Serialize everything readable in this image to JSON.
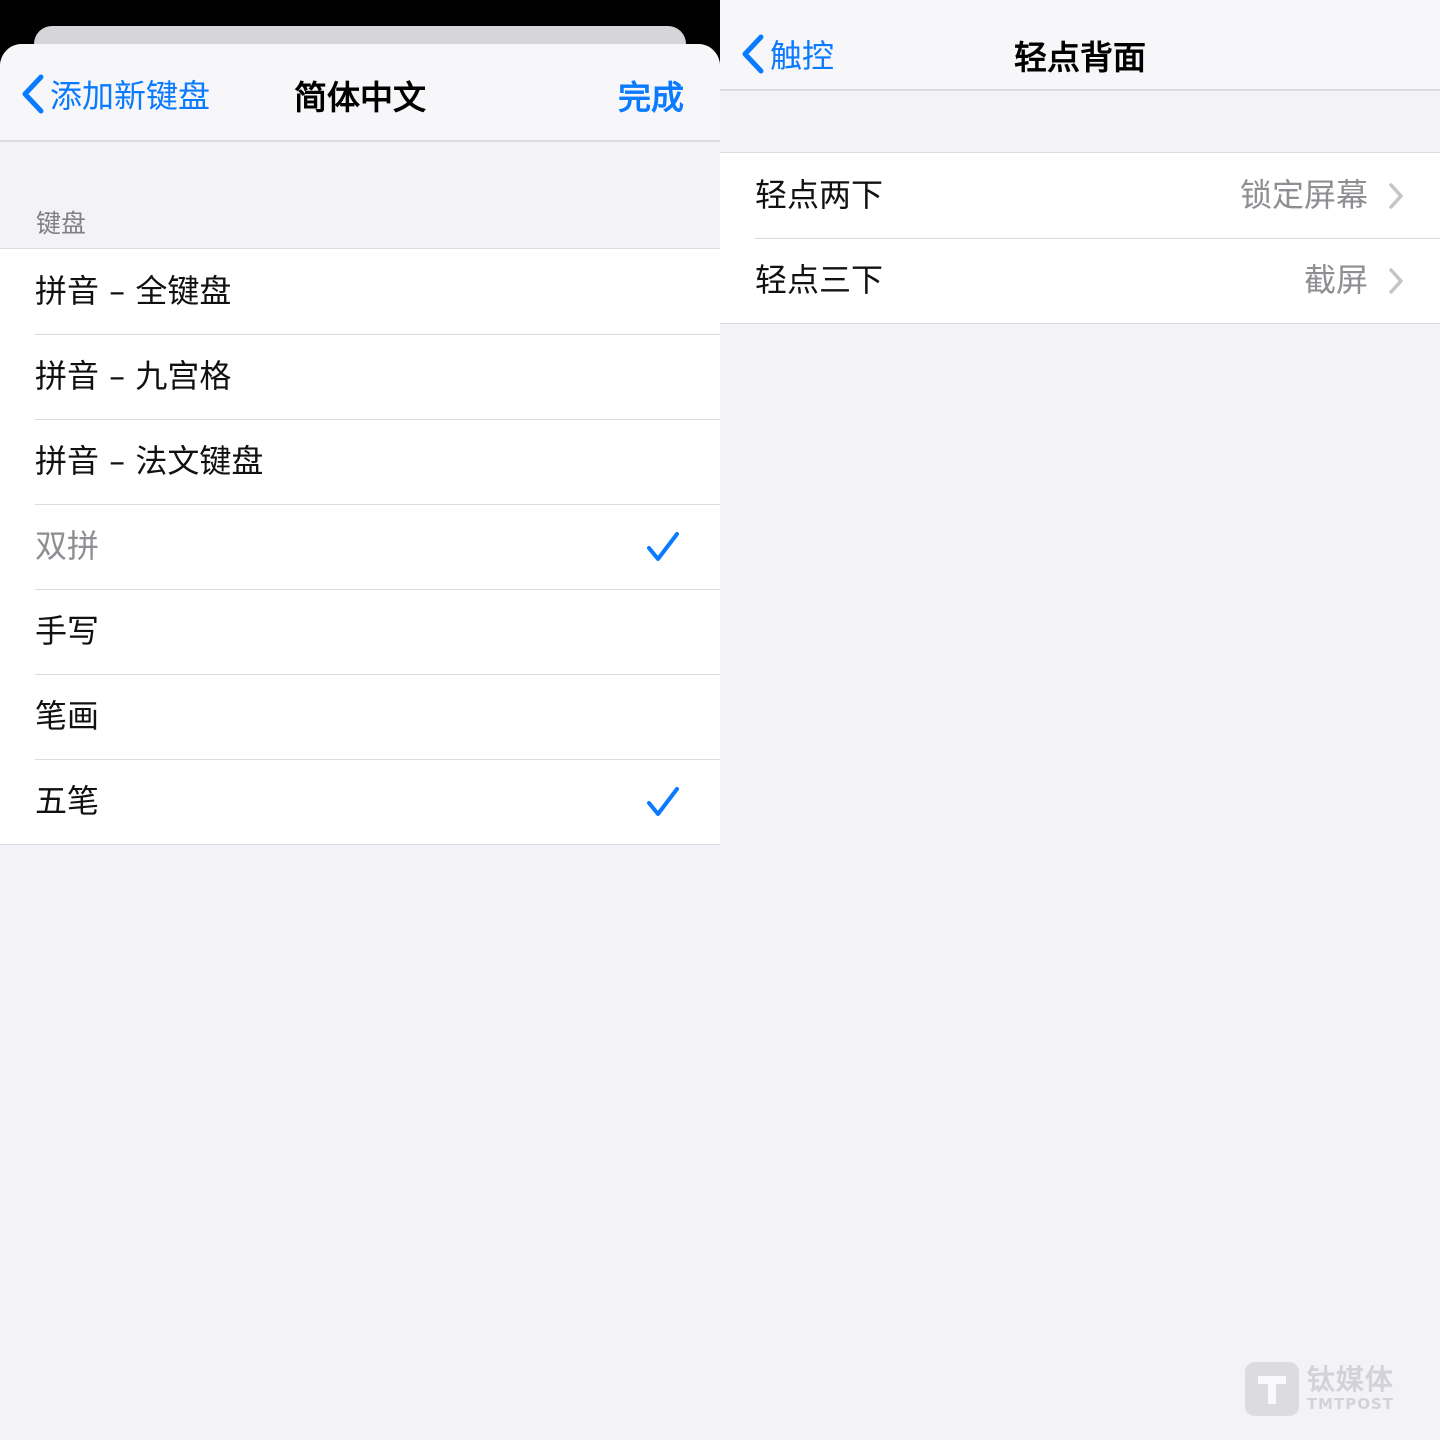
{
  "left": {
    "nav": {
      "back_label": "添加新键盘",
      "title": "简体中文",
      "done_label": "完成"
    },
    "section_header": "键盘",
    "rows": [
      {
        "label": "拼音 – 全键盘",
        "checked": false,
        "dimmed": false
      },
      {
        "label": "拼音 – 九宫格",
        "checked": false,
        "dimmed": false
      },
      {
        "label": "拼音 – 法文键盘",
        "checked": false,
        "dimmed": false
      },
      {
        "label": "双拼",
        "checked": true,
        "dimmed": true
      },
      {
        "label": "手写",
        "checked": false,
        "dimmed": false
      },
      {
        "label": "笔画",
        "checked": false,
        "dimmed": false
      },
      {
        "label": "五笔",
        "checked": true,
        "dimmed": false
      }
    ]
  },
  "right": {
    "nav": {
      "back_label": "触控",
      "title": "轻点背面"
    },
    "rows": [
      {
        "label": "轻点两下",
        "value": "锁定屏幕"
      },
      {
        "label": "轻点三下",
        "value": "截屏"
      }
    ]
  },
  "watermark": {
    "cn": "钛媒体",
    "en": "TMTPOST"
  },
  "colors": {
    "accent": "#0a7aff",
    "background": "#f2f2f7",
    "secondary_text": "#8e8e93"
  },
  "icons": {
    "back": "chevron-left-icon",
    "check": "checkmark-icon",
    "disclosure": "chevron-right-icon"
  }
}
